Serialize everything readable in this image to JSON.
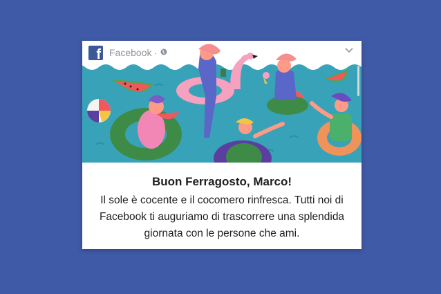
{
  "post": {
    "source": "Facebook",
    "separator": "·",
    "title": "Buon Ferragosto, Marco!",
    "body_lines": [
      "Il sole è cocente e il cocomero rinfresca. Tutti noi di",
      "Facebook ti auguriamo di trascorrere una splendida",
      "giornata con le persone che ami."
    ],
    "logo_letter": "f",
    "icons": {
      "logo": "facebook-logo-icon",
      "privacy": "globe-icon",
      "menu": "chevron-down-icon"
    },
    "colors": {
      "page_background": "#3f5aa6",
      "water": "#38a3b8",
      "brand": "#3b5998"
    }
  }
}
